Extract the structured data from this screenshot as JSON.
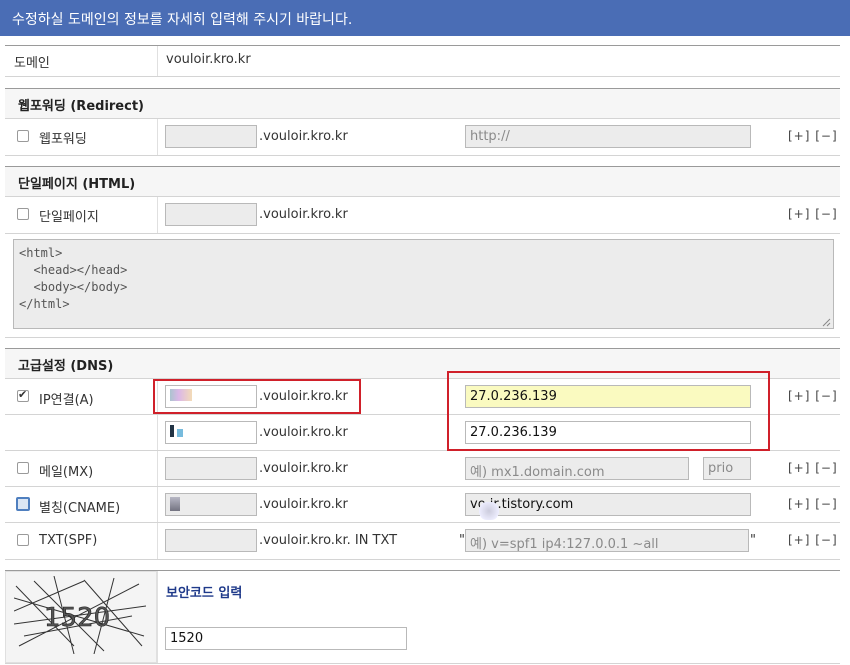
{
  "banner": "수정하실 도메인의 정보를 자세히 입력해 주시기 바랍니다.",
  "domain": {
    "label": "도메인",
    "value": "vouloir.kro.kr"
  },
  "suffix": ".vouloir.kro.kr",
  "suffix_txt": ".vouloir.kro.kr. IN TXT",
  "plus_minus": "[+] [−]",
  "redirect": {
    "header": "웹포워딩 (Redirect)",
    "label": "웹포워딩",
    "url_placeholder": "http://"
  },
  "single_page": {
    "header": "단일페이지 (HTML)",
    "label": "단일페이지",
    "html": "<html>\n  <head></head>\n  <body></body>\n</html>"
  },
  "dns": {
    "header": "고급설정 (DNS)",
    "ip_label": "IP연결(A)",
    "ip1": "27.0.236.139",
    "ip2": "27.0.236.139",
    "mx_label": "메일(MX)",
    "mx_placeholder": "예) mx1.domain.com",
    "prio_placeholder": "prio",
    "cname_label": "별칭(CNAME)",
    "cname_value": "vo   ir.tistory.com",
    "txt_label": "TXT(SPF)",
    "txt_placeholder": "예) v=spf1 ip4:127.0.0.1 ~all",
    "quote": "\""
  },
  "security": {
    "label": "보안코드 입력",
    "value": "1520",
    "captcha_text": "1520"
  },
  "colors": {
    "banner": "#4a6db5",
    "highlight": "#d0202a",
    "yellow_input": "#fafac0"
  }
}
